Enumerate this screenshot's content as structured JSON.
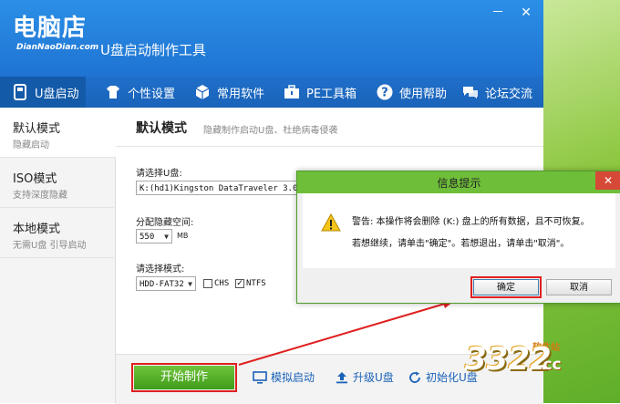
{
  "app": {
    "logo_cn": "电脑店",
    "logo_en": "DianNaoDian.com",
    "title": "U盘启动制作工具",
    "window_controls": {
      "minimize": "－",
      "close": "✕"
    }
  },
  "nav": {
    "items": [
      {
        "label": "U盘启动",
        "icon": "usb-icon"
      },
      {
        "label": "个性设置",
        "icon": "shirt-icon"
      },
      {
        "label": "常用软件",
        "icon": "cube-icon"
      },
      {
        "label": "PE工具箱",
        "icon": "toolbox-icon"
      },
      {
        "label": "使用帮助",
        "icon": "help-icon"
      },
      {
        "label": "论坛交流",
        "icon": "chat-icon"
      }
    ]
  },
  "sidebar": {
    "items": [
      {
        "title": "默认模式",
        "subtitle": "隐藏启动"
      },
      {
        "title": "ISO模式",
        "subtitle": "支持深度隐藏"
      },
      {
        "title": "本地模式",
        "subtitle": "无需U盘 引导启动"
      }
    ]
  },
  "main": {
    "title": "默认模式",
    "subtitle": "隐藏制作启动U盘、杜绝病毒侵袭",
    "select_usb_label": "请选择U盘:",
    "usb_value": "K:(hd1)Kingston DataTraveler 3.0 (2",
    "hidden_space_label": "分配隐藏空间:",
    "hidden_space_value": "550",
    "hidden_space_unit": "MB",
    "mode_label": "请选择模式:",
    "mode_value": "HDD-FAT32",
    "chs_label": "CHS",
    "chs_checked": false,
    "ntfs_label": "NTFS",
    "ntfs_checked": true
  },
  "bottom": {
    "start_label": "开始制作",
    "simulate_label": "模拟启动",
    "upgrade_label": "升级U盘",
    "init_label": "初始化U盘"
  },
  "dialog": {
    "title": "信息提示",
    "message1": "警告: 本操作将会删除 (K:) 盘上的所有数据，且不可恢复。",
    "message2": "若想继续，请单击\"确定\"。若想退出，请单击\"取消\"。",
    "ok_label": "确定",
    "cancel_label": "取消",
    "close_label": "✕"
  },
  "watermark": {
    "number": "3322",
    "domain": ".cc",
    "site": "软件站"
  },
  "colors": {
    "header_blue": "#2b8fe6",
    "dialog_green": "#6fbe3a",
    "start_green": "#4faa22",
    "highlight_red": "#e02020"
  }
}
